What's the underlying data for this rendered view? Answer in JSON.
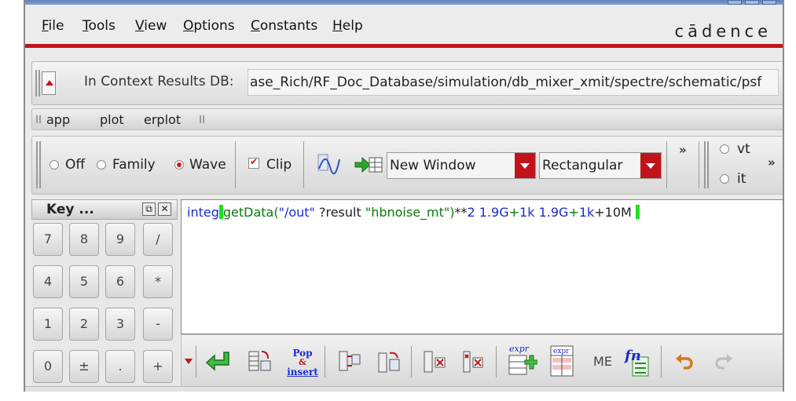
{
  "menubar": {
    "items": [
      {
        "mnemonic": "F",
        "rest": "ile"
      },
      {
        "mnemonic": "T",
        "rest": "ools"
      },
      {
        "mnemonic": "V",
        "rest": "iew"
      },
      {
        "mnemonic": "O",
        "rest": "ptions"
      },
      {
        "mnemonic": "C",
        "rest": "onstants"
      },
      {
        "mnemonic": "H",
        "rest": "elp"
      }
    ],
    "brand": "cādence"
  },
  "context": {
    "label": "In Context Results DB:",
    "path": "ase_Rich/RF_Doc_Database/simulation/db_mixer_xmit/spectre/schematic/psf"
  },
  "tabs": [
    "app",
    "plot",
    "erplot"
  ],
  "toolbar": {
    "radios": [
      {
        "label": "Off",
        "selected": false
      },
      {
        "label": "Family",
        "selected": false
      },
      {
        "label": "Wave",
        "selected": true
      }
    ],
    "clip_label": "Clip",
    "clip_checked": true,
    "window_select": "New Window",
    "plot_type_select": "Rectangular",
    "more_chevron": "»",
    "overflow_chevron": "»",
    "probe_radios": [
      "vt",
      "it"
    ]
  },
  "keypad": {
    "title": "Key ...",
    "float_button": "⧉",
    "close_button": "✕",
    "keys": [
      "7",
      "8",
      "9",
      "/",
      "4",
      "5",
      "6",
      "*",
      "1",
      "2",
      "3",
      "-",
      "0",
      "±",
      ".",
      "+"
    ]
  },
  "editor": {
    "segments": [
      {
        "text": "integ",
        "color": "blue"
      },
      {
        "text": "getData(",
        "color": "green"
      },
      {
        "text": "\"/out\"",
        "color": "blue"
      },
      {
        "text": " ?result ",
        "color": "dark"
      },
      {
        "text": "\"hbnoise_mt\"",
        "color": "green"
      },
      {
        "text": ")",
        "color": "green"
      },
      {
        "text": "**",
        "color": "dark"
      },
      {
        "text": "2 1.9G",
        "color": "blue"
      },
      {
        "text": "+",
        "color": "green"
      },
      {
        "text": "1k 1.9G",
        "color": "blue"
      },
      {
        "text": "+",
        "color": "green"
      },
      {
        "text": "1k",
        "color": "blue"
      },
      {
        "text": "+",
        "color": "dark"
      },
      {
        "text": "10M ",
        "color": "dark"
      }
    ]
  },
  "bottombar": {
    "pop_insert_top": "Pop",
    "pop_insert_mid": "&",
    "pop_insert_bottom": "insert",
    "expr_label": "expr",
    "me_label": "ME",
    "fn_label": "fn"
  },
  "colors": {
    "accent_red": "#c0141a",
    "keyword_blue": "#1a2bd0",
    "keyword_green": "#0a7a0a"
  }
}
